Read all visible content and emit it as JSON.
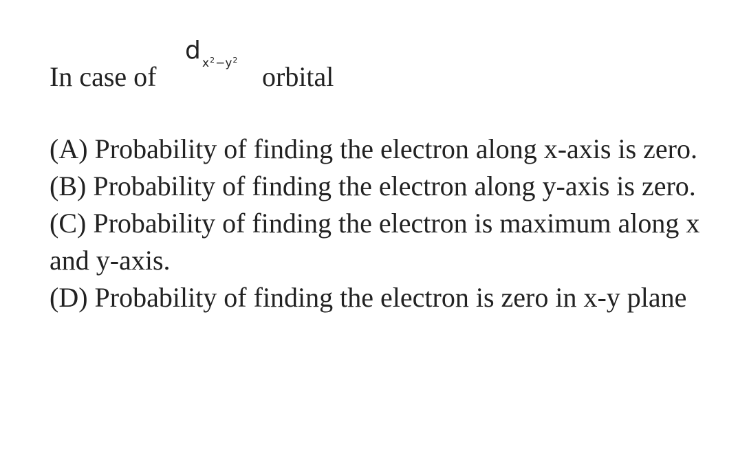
{
  "question": {
    "prefix": "In case of",
    "orbital": {
      "letter": "d",
      "sub_x": "x",
      "sup_1": "2",
      "minus": "−",
      "sub_y": "y",
      "sup_2": "2"
    },
    "suffix": "orbital"
  },
  "options": [
    {
      "text": "(A) Probability of finding the electron along x-axis is zero."
    },
    {
      "text": "(B) Probability of finding the electron along y-axis is zero."
    },
    {
      "text": "(C) Probability of finding the electron is maximum along x and y-axis."
    },
    {
      "text": "(D) Probability of finding the electron is zero in x-y plane"
    }
  ]
}
